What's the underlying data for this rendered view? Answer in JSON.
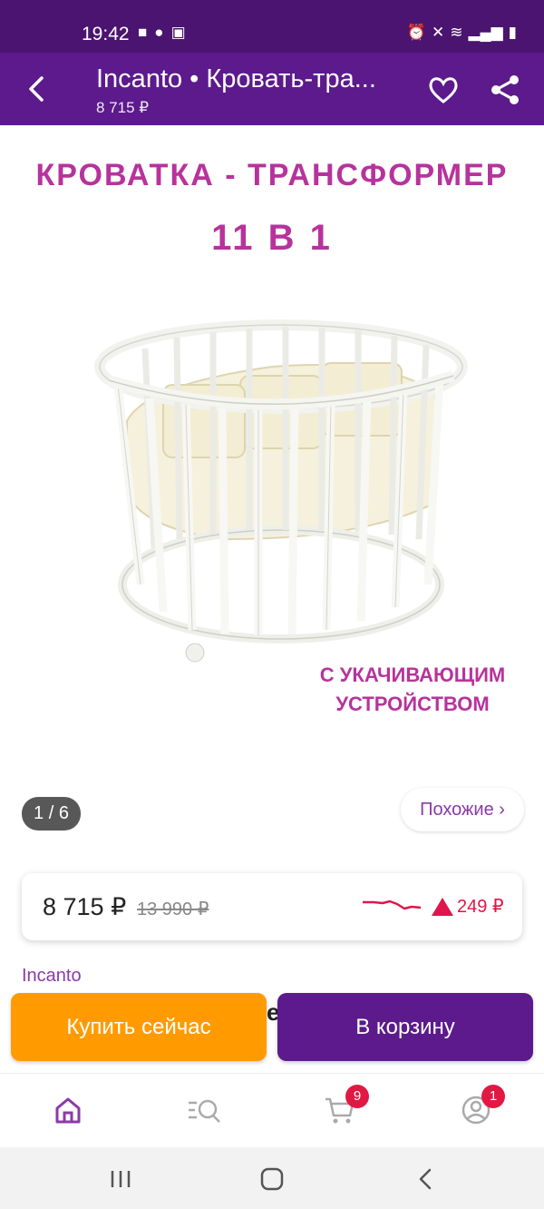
{
  "status_bar": {
    "time": "19:42"
  },
  "app_bar": {
    "title": "Incanto • Кровать-тра...",
    "price": "8 715 ₽"
  },
  "product_image": {
    "promo_title": "КРОВАТКА - ТРАНСФОРМЕР",
    "promo_sub": "11 В 1",
    "promo_note_line1": "С УКАЧИВАЮЩИМ",
    "promo_note_line2": "УСТРОЙСТВОМ",
    "page_counter": "1 / 6",
    "similar_label": "Похожие ›"
  },
  "price_card": {
    "current": "8 715 ₽",
    "old": "13 990 ₽",
    "change": "249 ₽"
  },
  "brand": "Incanto",
  "partial_text": "е",
  "actions": {
    "buy_now": "Купить сейчас",
    "add_to_cart": "В корзину"
  },
  "bottom_nav": {
    "cart_badge": "9",
    "profile_badge": "1"
  },
  "colors": {
    "status_bar": "#4a1470",
    "app_bar": "#5c1a8c",
    "accent_purple": "#8b3aa8",
    "promo_pink": "#b7339c",
    "buy_orange": "#ff9b00",
    "price_up_red": "#e0154a"
  }
}
